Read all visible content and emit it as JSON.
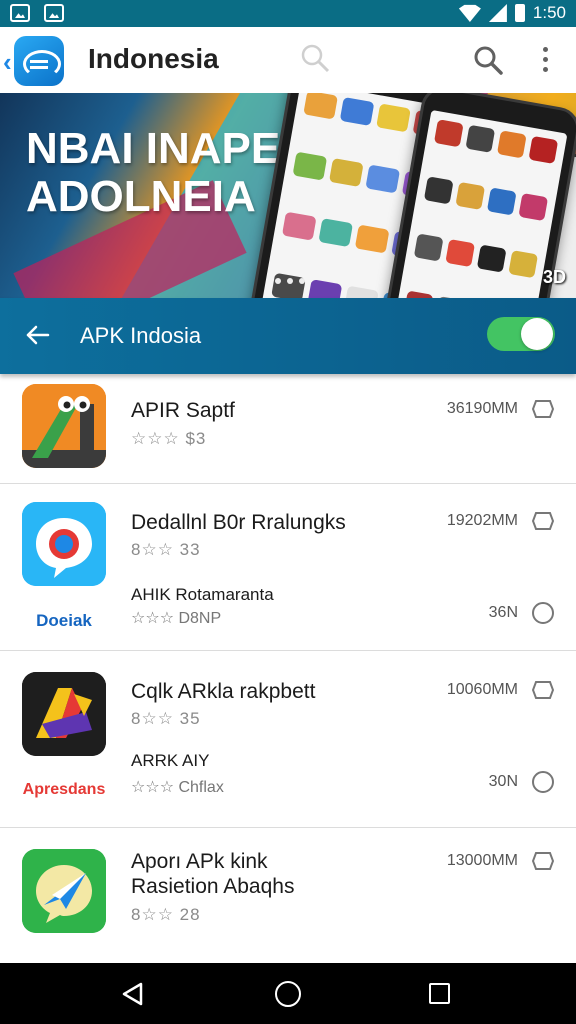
{
  "status_bar": {
    "time": "1:50"
  },
  "app_bar": {
    "title": "Indonesia"
  },
  "banner": {
    "line1": "NBAI INAPE",
    "line2": "ADOLNEIA",
    "badge": "3D"
  },
  "section": {
    "title": "APK Indosia",
    "toggle_on": true
  },
  "apps": [
    {
      "name": "APIR Saptf",
      "rating": "☆☆☆ $3",
      "size": "36190MM"
    },
    {
      "name": "Dedallnl B0r Rralungks",
      "rating": "8☆☆ 33",
      "size": "19202MM",
      "sub": {
        "label": "Doeiak",
        "name": "AHIK Rotamaranta",
        "rating": "☆☆☆ D8NP",
        "size": "36N"
      }
    },
    {
      "name": "Cqlk ARkla rakpbett",
      "rating": "8☆☆ 35",
      "size": "10060MM",
      "sub": {
        "label": "Apresdans",
        "name": "ARRK AIY",
        "rating": "☆☆☆ Chflax",
        "size": "30N"
      }
    },
    {
      "name": "Aporı APk kink",
      "name2": "Rasietion Abaqhs",
      "rating": "8☆☆ 28",
      "size": "13000MM"
    }
  ],
  "colors": {
    "accent": "#0d6f9d",
    "toggle": "#43c463",
    "sub_label_blue": "#1565c0"
  }
}
